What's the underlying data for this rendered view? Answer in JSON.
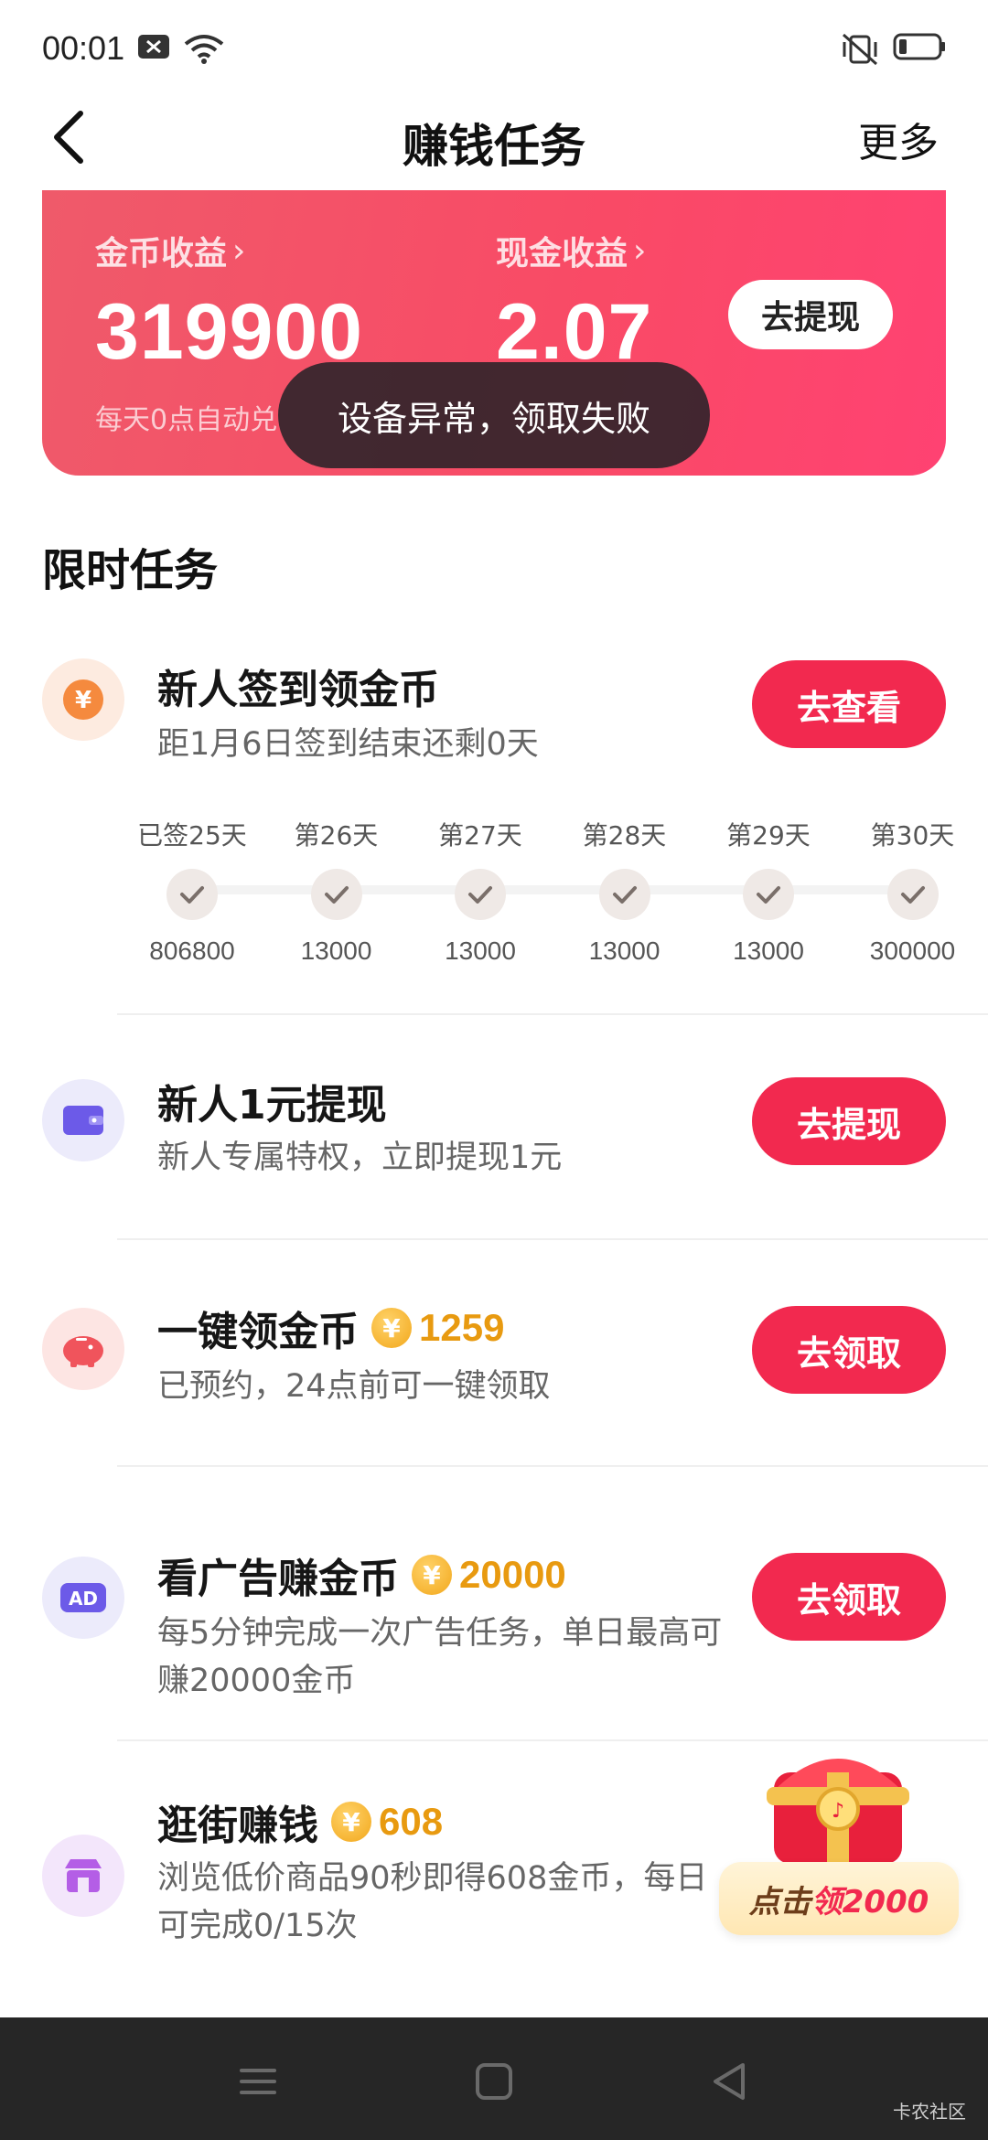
{
  "status_bar": {
    "time": "00:01"
  },
  "nav": {
    "title": "赚钱任务",
    "more": "更多"
  },
  "earnings": {
    "coin_label": "金币收益",
    "coin_value": "319900",
    "cash_label": "现金收益",
    "cash_value": "2.07",
    "note": "每天0点自动兑",
    "withdraw": "去提现"
  },
  "toast": "设备异常，领取失败",
  "section_title": "限时任务",
  "tasks": [
    {
      "title": "新人签到领金币",
      "desc": "距1月6日签到结束还剩0天",
      "button": "去查看",
      "icon": "yuan-coin-icon"
    },
    {
      "title": "新人1元提现",
      "desc": "新人专属特权，立即提现1元",
      "button": "去提现",
      "icon": "wallet-icon"
    },
    {
      "title": "一键领金币",
      "coins": "1259",
      "desc": "已预约，24点前可一键领取",
      "button": "去领取",
      "icon": "piggy-bank-icon"
    },
    {
      "title": "看广告赚金币",
      "coins": "20000",
      "desc": "每5分钟完成一次广告任务，单日最高可赚20000金币",
      "button": "去领取",
      "icon": "ad-icon"
    },
    {
      "title": "逛街赚钱",
      "coins": "608",
      "desc": "浏览低价商品90秒即得608金币，每日可完成0/15次",
      "icon": "shop-icon"
    }
  ],
  "signin_days": [
    {
      "label": "已签25天",
      "coins": "806800"
    },
    {
      "label": "第26天",
      "coins": "13000"
    },
    {
      "label": "第27天",
      "coins": "13000"
    },
    {
      "label": "第28天",
      "coins": "13000"
    },
    {
      "label": "第29天",
      "coins": "13000"
    },
    {
      "label": "第30天",
      "coins": "300000"
    }
  ],
  "floating": {
    "prefix": "点击",
    "highlight": "领2000"
  },
  "coin_symbol": "¥",
  "watermark": "卡农社区"
}
